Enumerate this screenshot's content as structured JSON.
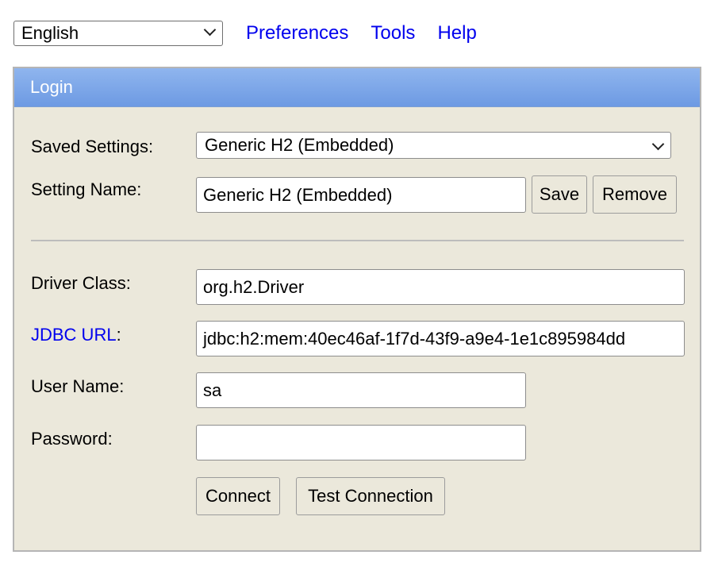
{
  "toolbar": {
    "language": "English",
    "links": [
      "Preferences",
      "Tools",
      "Help"
    ]
  },
  "login": {
    "title": "Login",
    "saved_settings_label": "Saved Settings:",
    "saved_settings_value": "Generic H2 (Embedded)",
    "setting_name_label": "Setting Name:",
    "setting_name_value": "Generic H2 (Embedded)",
    "save_label": "Save",
    "remove_label": "Remove",
    "driver_class_label": "Driver Class:",
    "driver_class_value": "org.h2.Driver",
    "jdbc_url_link": "JDBC URL",
    "jdbc_url_colon": ":",
    "jdbc_url_value": "jdbc:h2:mem:40ec46af-1f7d-43f9-a9e4-1e1c895984dd",
    "user_name_label": "User Name:",
    "user_name_value": "sa",
    "password_label": "Password:",
    "password_value": "",
    "connect_label": "Connect",
    "test_connection_label": "Test Connection"
  },
  "colors": {
    "link": "#0000ee",
    "header": "#7ba5e8",
    "panel_bg": "#ebe8db"
  }
}
